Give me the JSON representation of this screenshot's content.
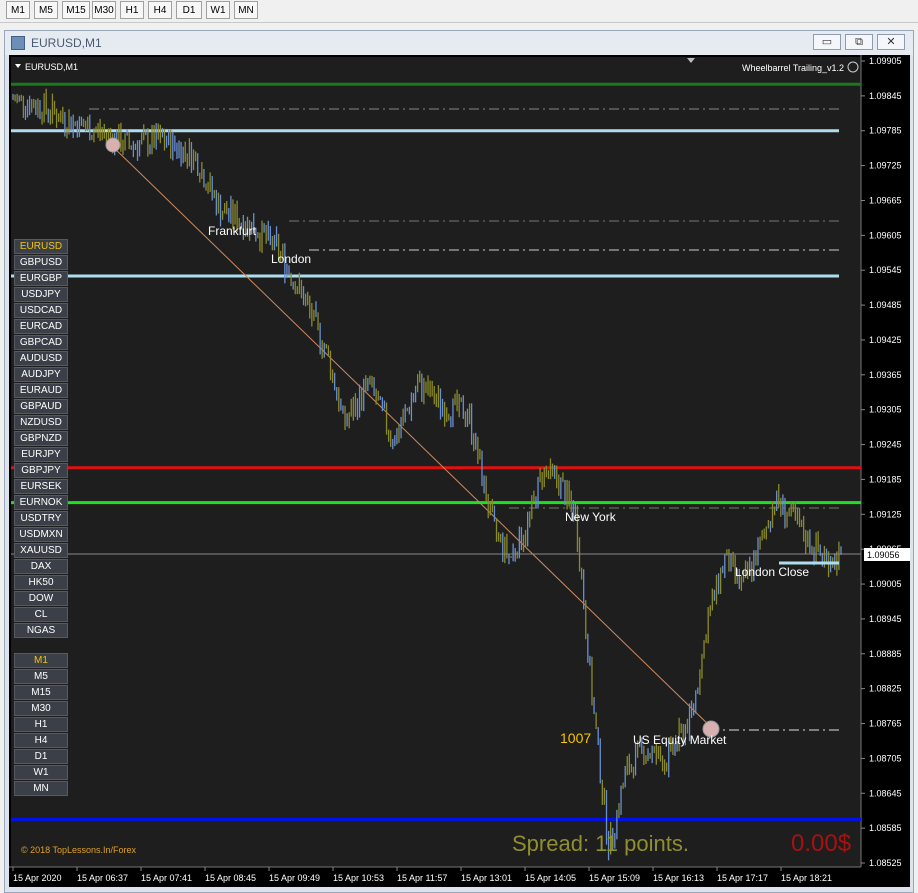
{
  "toolbar": {
    "timeframes": [
      "M1",
      "M5",
      "M15",
      "M30",
      "H1",
      "H4",
      "D1",
      "W1",
      "MN"
    ]
  },
  "window": {
    "title": "EURUSD,M1",
    "minimize": "▭",
    "restore": "⧉",
    "close": "✕"
  },
  "chart": {
    "symbol_label": "EURUSD,M1",
    "indicator_label": "Wheelbarrel Trailing_v1.2",
    "price_tag": "1.09056",
    "sessions": [
      "Frankfurt",
      "London",
      "New York",
      "US Equity Market",
      "London Close"
    ],
    "count_label": "1007",
    "spread": "Spread: 11 points.",
    "profit": "0.00$",
    "copyright": "© 2018 TopLessons.In/Forex",
    "colors": {
      "background": "#000000",
      "candle": "#8a8a2a",
      "candle_alt": "#6a8fd0",
      "level_green_dark": "#1a7a1a",
      "level_light_blue": "#aeddee",
      "level_red": "#e01010",
      "level_green": "#22dd22",
      "level_blue": "#0010ee",
      "spread": "#8f8f2f",
      "profit": "#aa1010"
    }
  },
  "panel": {
    "symbols": [
      "EURUSD",
      "GBPUSD",
      "EURGBP",
      "USDJPY",
      "USDCAD",
      "EURCAD",
      "GBPCAD",
      "AUDUSD",
      "AUDJPY",
      "EURAUD",
      "GBPAUD",
      "NZDUSD",
      "GBPNZD",
      "EURJPY",
      "GBPJPY",
      "EURSEK",
      "EURNOK",
      "USDTRY",
      "USDMXN",
      "XAUUSD",
      "DAX",
      "HK50",
      "DOW",
      "CL",
      "NGAS"
    ],
    "active_symbol": "EURUSD",
    "timeframes": [
      "M1",
      "M5",
      "M15",
      "M30",
      "H1",
      "H4",
      "D1",
      "W1",
      "MN"
    ],
    "active_timeframe": "M1"
  },
  "chart_data": {
    "type": "candlestick",
    "price_axis": [
      "1.09905",
      "1.09845",
      "1.09785",
      "1.09725",
      "1.09665",
      "1.09605",
      "1.09545",
      "1.09485",
      "1.09425",
      "1.09365",
      "1.09305",
      "1.09245",
      "1.09185",
      "1.09125",
      "1.09065",
      "1.09005",
      "1.08945",
      "1.08885",
      "1.08825",
      "1.08765",
      "1.08705",
      "1.08645",
      "1.08585",
      "1.08525"
    ],
    "time_axis": [
      "15 Apr 2020",
      "15 Apr 06:37",
      "15 Apr 07:41",
      "15 Apr 08:45",
      "15 Apr 09:49",
      "15 Apr 10:53",
      "15 Apr 11:57",
      "15 Apr 13:01",
      "15 Apr 14:05",
      "15 Apr 15:09",
      "15 Apr 16:13",
      "15 Apr 17:17",
      "15 Apr 18:21"
    ],
    "ylim": [
      1.08525,
      1.09905
    ],
    "levels": [
      {
        "price": 1.09865,
        "color": "#1a7a1a"
      },
      {
        "price": 1.09785,
        "color": "#aeddee"
      },
      {
        "price": 1.09535,
        "color": "#aeddee"
      },
      {
        "price": 1.09205,
        "color": "#e01010"
      },
      {
        "price": 1.09145,
        "color": "#22dd22"
      },
      {
        "price": 1.086,
        "color": "#0010ee"
      }
    ],
    "current_price": 1.09056,
    "price_path": [
      [
        0,
        1.0984
      ],
      [
        0.03,
        1.0983
      ],
      [
        0.07,
        1.098
      ],
      [
        0.11,
        1.0978
      ],
      [
        0.14,
        1.0976
      ],
      [
        0.18,
        1.0977
      ],
      [
        0.22,
        1.0974
      ],
      [
        0.25,
        1.0965
      ],
      [
        0.29,
        1.0962
      ],
      [
        0.32,
        1.0958
      ],
      [
        0.35,
        1.095
      ],
      [
        0.38,
        1.094
      ],
      [
        0.4,
        1.0928
      ],
      [
        0.43,
        1.0935
      ],
      [
        0.46,
        1.0925
      ],
      [
        0.49,
        1.0935
      ],
      [
        0.52,
        1.0931
      ],
      [
        0.55,
        1.093
      ],
      [
        0.58,
        1.091
      ],
      [
        0.6,
        1.0905
      ],
      [
        0.62,
        1.091
      ],
      [
        0.64,
        1.092
      ],
      [
        0.66,
        1.0918
      ],
      [
        0.68,
        1.0912
      ],
      [
        0.7,
        1.088
      ],
      [
        0.72,
        1.0855
      ],
      [
        0.74,
        1.0868
      ],
      [
        0.76,
        1.0872
      ],
      [
        0.79,
        1.087
      ],
      [
        0.82,
        1.0878
      ],
      [
        0.84,
        1.0895
      ],
      [
        0.86,
        1.0905
      ],
      [
        0.88,
        1.09
      ],
      [
        0.9,
        1.0906
      ],
      [
        0.92,
        1.0915
      ],
      [
        0.94,
        1.0912
      ],
      [
        0.96,
        1.0908
      ],
      [
        0.98,
        1.0905
      ]
    ]
  }
}
